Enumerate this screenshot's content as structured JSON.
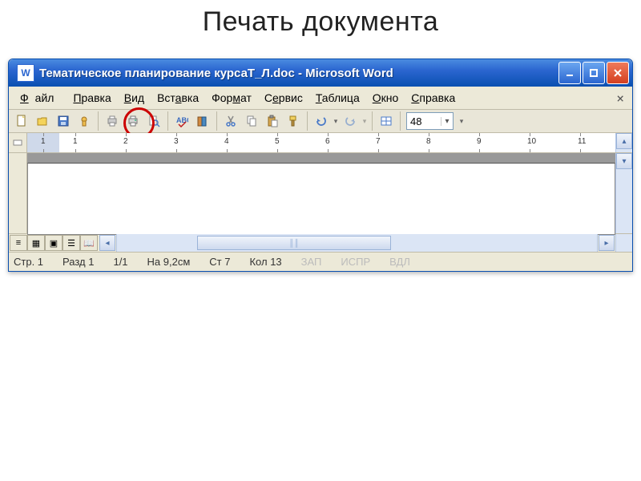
{
  "heading": "Печать документа",
  "window": {
    "title": "Тематическое планирование курсаТ_Л.doc - Microsoft Word",
    "app_icon": "W"
  },
  "menu": {
    "file": "Файл",
    "edit": "Правка",
    "view": "Вид",
    "insert": "Вставка",
    "format": "Формат",
    "tools": "Сервис",
    "table": "Таблица",
    "window": "Окно",
    "help": "Справка"
  },
  "toolbar": {
    "zoom": "48"
  },
  "ruler": {
    "ticks": [
      "1",
      "2",
      "1",
      "2",
      "3",
      "4",
      "5",
      "6",
      "7",
      "8",
      "9",
      "10",
      "11"
    ]
  },
  "status": {
    "page": "Стр. 1",
    "section": "Разд 1",
    "pages": "1/1",
    "at": "На 9,2см",
    "line": "Ст 7",
    "col": "Кол 13",
    "rec": "ЗАП",
    "trk": "ИСПР",
    "ext": "ВДЛ"
  }
}
